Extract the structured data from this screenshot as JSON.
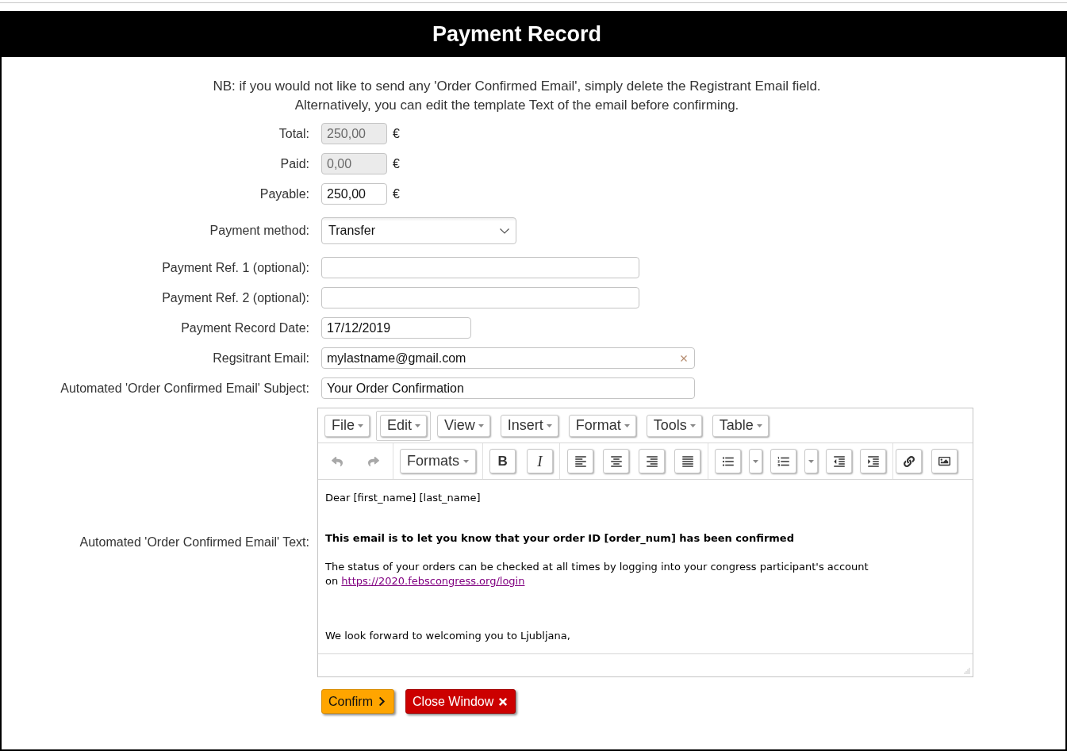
{
  "header": {
    "title": "Payment Record"
  },
  "notice": [
    "NB: if you would not like to send any 'Order Confirmed Email', simply delete the Registrant Email field.",
    "Alternatively, you can edit the template Text of the email before confirming."
  ],
  "form": {
    "fields": [
      {
        "kind": "amount",
        "label": "Total:",
        "value": "250,00",
        "currency": "€",
        "disabled": true
      },
      {
        "kind": "amount",
        "label": "Paid:",
        "value": "0,00",
        "currency": "€",
        "disabled": true
      },
      {
        "kind": "amount",
        "label": "Payable:",
        "value": "250,00",
        "currency": "€",
        "disabled": false
      },
      {
        "kind": "select",
        "label": "Payment method:",
        "value": "Transfer"
      },
      {
        "kind": "reference",
        "label": "Payment Ref. 1 (optional):"
      },
      {
        "kind": "reference",
        "label": "Payment Ref. 2 (optional):"
      },
      {
        "kind": "date",
        "label": "Payment Record Date:",
        "value": "17/12/2019"
      },
      {
        "kind": "email",
        "label": "Regsitrant Email:",
        "value": "mylastname@gmail.com"
      },
      {
        "kind": "subject",
        "label": "Automated 'Order Confirmed Email' Subject:",
        "value": "Your Order Confirmation"
      }
    ]
  },
  "editor": {
    "label": "Automated 'Order Confirmed Email' Text:",
    "menubar": [
      {
        "label": "File",
        "focused": false
      },
      {
        "label": "Edit",
        "focused": true
      },
      {
        "label": "View",
        "focused": false
      },
      {
        "label": "Insert",
        "focused": false
      },
      {
        "label": "Format",
        "focused": false
      },
      {
        "label": "Tools",
        "focused": false
      },
      {
        "label": "Table",
        "focused": false
      }
    ],
    "toolbar": {
      "undo": {
        "disabled": true
      },
      "redo": {
        "disabled": true
      },
      "formats": "Formats",
      "bold": "B",
      "italic": "I"
    },
    "content": [
      {
        "kind": "greeting",
        "text": "Dear [first_name] [last_name]"
      },
      {
        "kind": "heading",
        "text": "This email is to let you know that your order ID [order_num] has been confirmed"
      },
      {
        "kind": "body",
        "text": "The status of your orders can be checked at all times by logging into your congress participant's account",
        "continuation": "on",
        "link": "https://2020.febscongress.org/login"
      },
      {
        "kind": "closing",
        "text": "We look forward to welcoming you to Ljubljana,"
      }
    ]
  },
  "buttons": [
    {
      "kind": "confirm",
      "label": "Confirm"
    },
    {
      "kind": "close",
      "label": "Close Window"
    }
  ]
}
